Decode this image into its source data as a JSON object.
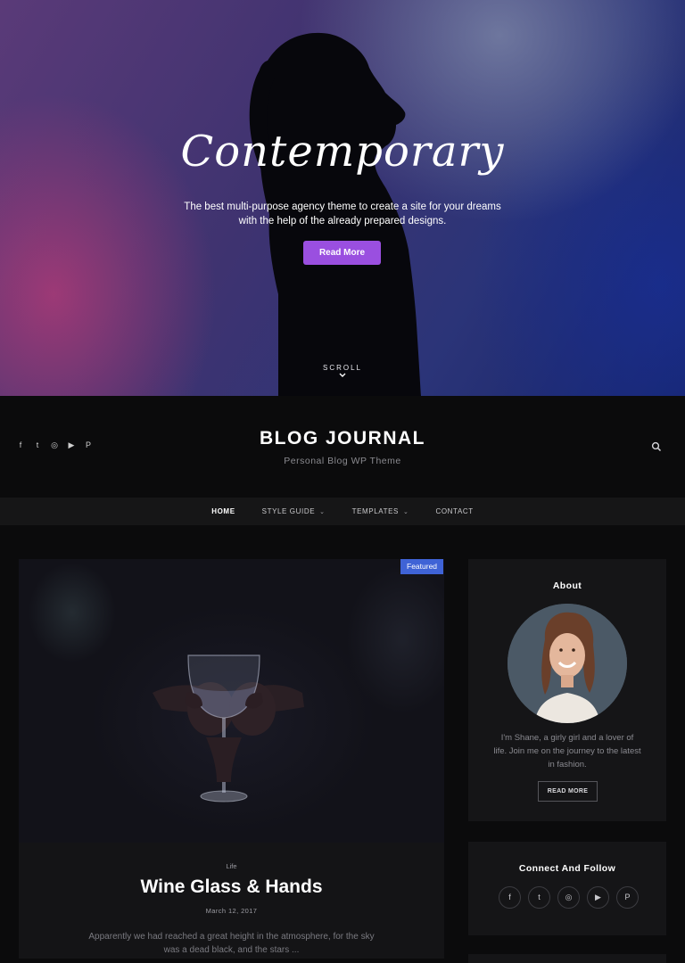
{
  "hero": {
    "title": "Contemporary",
    "subtitle": "The best multi-purpose agency theme to create a site for your dreams with the help of the already prepared designs.",
    "button_label": "Read More",
    "scroll_label": "SCROLL",
    "button_color": "#9a4fe0"
  },
  "header": {
    "social_icons": [
      "f",
      "t",
      "◎",
      "▶",
      "P"
    ],
    "brand": "BLOG JOURNAL",
    "tagline": "Personal Blog WP Theme"
  },
  "nav": {
    "items": [
      {
        "label": "HOME",
        "active": true
      },
      {
        "label": "STYLE GUIDE",
        "dropdown": true
      },
      {
        "label": "TEMPLATES",
        "dropdown": true
      },
      {
        "label": "CONTACT"
      }
    ]
  },
  "post": {
    "badge": "Featured",
    "badge_color": "#3f63d6",
    "category": "Life",
    "title": "Wine Glass & Hands",
    "date": "March 12, 2017",
    "excerpt": "Apparently we had reached a great height in the atmosphere, for the sky was a dead black, and the stars ..."
  },
  "sidebar": {
    "about": {
      "title": "About",
      "text": "I'm Shane, a girly girl and a lover of life. Join me on the journey to the latest in fashion.",
      "button_label": "READ MORE"
    },
    "connect": {
      "title": "Connect And Follow",
      "icons": [
        "f",
        "t",
        "◎",
        "▶",
        "P"
      ]
    }
  }
}
